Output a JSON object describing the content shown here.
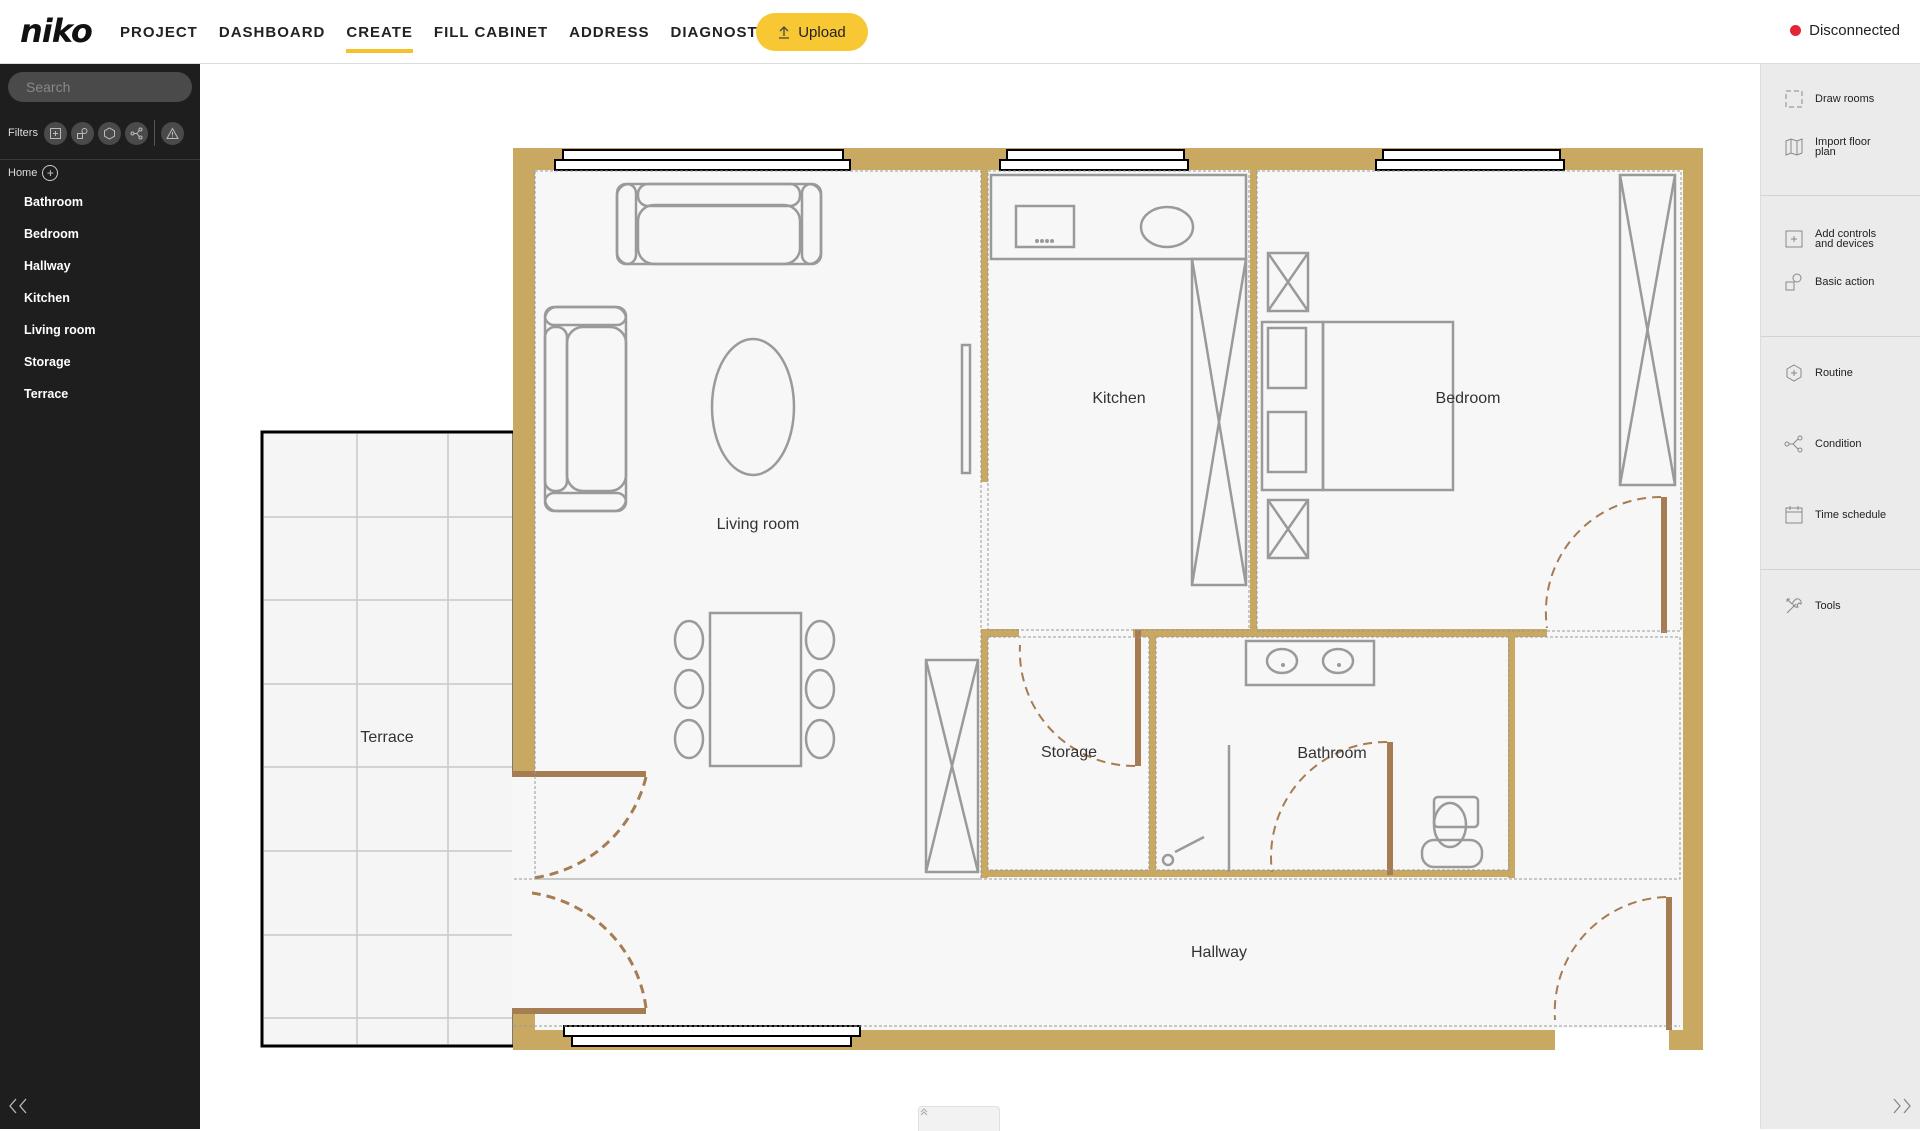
{
  "app": {
    "logo": "niko"
  },
  "nav": {
    "items": [
      {
        "label": "PROJECT"
      },
      {
        "label": "DASHBOARD"
      },
      {
        "label": "CREATE",
        "active": true
      },
      {
        "label": "FILL CABINET"
      },
      {
        "label": "ADDRESS"
      },
      {
        "label": "DIAGNOSTICS",
        "external": true
      }
    ],
    "upload_label": "Upload"
  },
  "status": {
    "label": "Disconnected",
    "color": "#e32636"
  },
  "sidebar": {
    "search_placeholder": "Search",
    "filters_label": "Filters",
    "filter_icons": [
      "add-box-icon",
      "shapes-icon",
      "hexagon-icon",
      "branch-icon",
      "warning-icon"
    ],
    "home_label": "Home",
    "rooms": [
      "Bathroom",
      "Bedroom",
      "Hallway",
      "Kitchen",
      "Living room",
      "Storage",
      "Terrace"
    ]
  },
  "tools": {
    "draw_rooms": "Draw rooms",
    "import_floor_plan_line1": "Import floor",
    "import_floor_plan_line2": "plan",
    "add_controls_line1": "Add controls",
    "add_controls_line2": "and devices",
    "basic_action": "Basic action",
    "routine": "Routine",
    "condition": "Condition",
    "time_schedule": "Time schedule",
    "tools": "Tools"
  },
  "floorplan": {
    "labels": {
      "living_room": "Living room",
      "kitchen": "Kitchen",
      "bedroom": "Bedroom",
      "storage": "Storage",
      "bathroom": "Bathroom",
      "hallway": "Hallway",
      "terrace": "Terrace"
    },
    "colors": {
      "wall": "#c9a862",
      "door": "#a67c52",
      "floor": "#f7f7f7",
      "furniture": "#9a9a9a"
    }
  },
  "accent_color": "#f5c329"
}
